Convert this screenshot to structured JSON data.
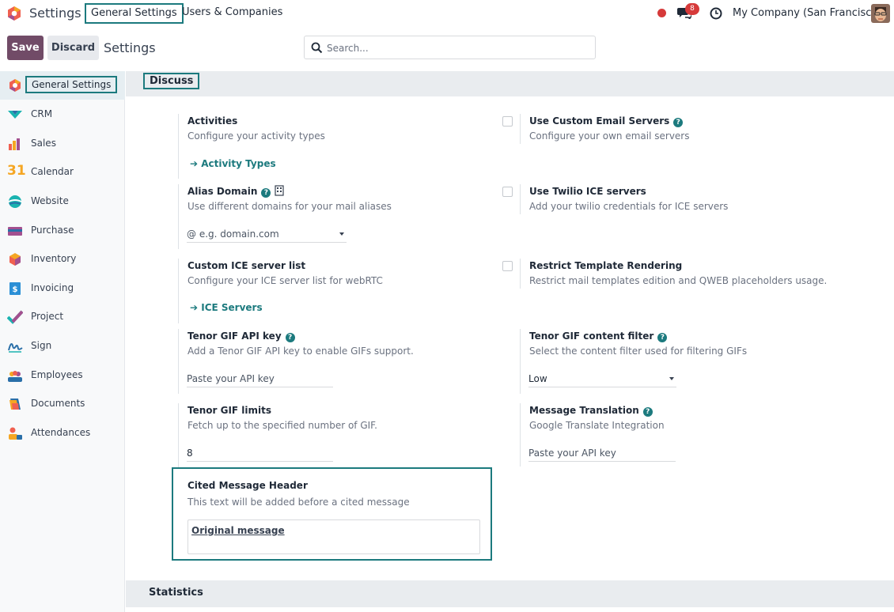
{
  "navbar": {
    "app_title": "Settings",
    "menu": [
      "General Settings",
      "Users & Companies"
    ],
    "chat_count": "8",
    "company": "My Company (San Francisco)"
  },
  "control_panel": {
    "save_label": "Save",
    "discard_label": "Discard",
    "title": "Settings",
    "search_placeholder": "Search..."
  },
  "sidebar": {
    "items": [
      {
        "label": "General Settings",
        "icon": "odoo-logo-icon",
        "active": true
      },
      {
        "label": "CRM",
        "icon": "crm-icon"
      },
      {
        "label": "Sales",
        "icon": "sales-chart-icon"
      },
      {
        "label": "Calendar",
        "icon": "calendar-icon",
        "icon_text": "31"
      },
      {
        "label": "Website",
        "icon": "website-globe-icon"
      },
      {
        "label": "Purchase",
        "icon": "purchase-card-icon"
      },
      {
        "label": "Inventory",
        "icon": "inventory-box-icon"
      },
      {
        "label": "Invoicing",
        "icon": "invoicing-icon",
        "icon_text": "$"
      },
      {
        "label": "Project",
        "icon": "project-check-icon"
      },
      {
        "label": "Sign",
        "icon": "sign-signature-icon"
      },
      {
        "label": "Employees",
        "icon": "employees-icon"
      },
      {
        "label": "Documents",
        "icon": "documents-icon"
      },
      {
        "label": "Attendances",
        "icon": "attendances-icon"
      }
    ]
  },
  "main": {
    "section_title": "Discuss",
    "next_section_title": "Statistics",
    "activities": {
      "title": "Activities",
      "desc": "Configure your activity types",
      "link": "Activity Types"
    },
    "custom_email": {
      "title": "Use Custom Email Servers",
      "desc": "Configure your own email servers"
    },
    "alias_domain": {
      "title": "Alias Domain",
      "desc": "Use different domains for your mail aliases",
      "placeholder": "@ e.g. domain.com"
    },
    "twilio": {
      "title": "Use Twilio ICE servers",
      "desc": "Add your twilio credentials for ICE servers"
    },
    "ice_list": {
      "title": "Custom ICE server list",
      "desc": "Configure your ICE server list for webRTC",
      "link": "ICE Servers"
    },
    "restrict_template": {
      "title": "Restrict Template Rendering",
      "desc": "Restrict mail templates edition and QWEB placeholders usage."
    },
    "tenor_key": {
      "title": "Tenor GIF API key",
      "desc": "Add a Tenor GIF API key to enable GIFs support.",
      "placeholder": "Paste your API key"
    },
    "tenor_filter": {
      "title": "Tenor GIF content filter",
      "desc": "Select the content filter used for filtering GIFs",
      "value": "Low"
    },
    "tenor_limits": {
      "title": "Tenor GIF limits",
      "desc": "Fetch up to the specified number of GIF.",
      "value": "8"
    },
    "translation": {
      "title": "Message Translation",
      "desc": "Google Translate Integration",
      "placeholder": "Paste your API key"
    },
    "cited": {
      "title": "Cited Message Header",
      "desc": "This text will be added before a cited message",
      "value": "Original message"
    }
  },
  "colors": {
    "accent": "#1c7a7e",
    "brand": "#714b67",
    "alert": "#d63a3a"
  }
}
